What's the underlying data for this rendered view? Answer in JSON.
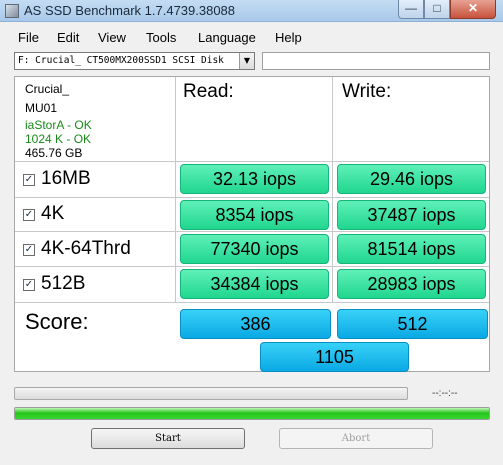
{
  "window": {
    "title": "AS SSD Benchmark 1.7.4739.38088"
  },
  "menu": [
    "File",
    "Edit",
    "View",
    "Tools",
    "Language",
    "Help"
  ],
  "drive": {
    "selected": "F: Crucial_ CT500MX200SSD1 SCSI Disk"
  },
  "info": {
    "model": "Crucial_",
    "firmware": "MU01",
    "driver": "iaStorA - OK",
    "alignment": "1024 K - OK",
    "size": "465.76 GB"
  },
  "columns": {
    "read": "Read:",
    "write": "Write:"
  },
  "rows": [
    {
      "label": "16MB",
      "checked": true,
      "read": "32.13 iops",
      "write": "29.46 iops"
    },
    {
      "label": "4K",
      "checked": true,
      "read": "8354 iops",
      "write": "37487 iops"
    },
    {
      "label": "4K-64Thrd",
      "checked": true,
      "read": "77340 iops",
      "write": "81514 iops"
    },
    {
      "label": "512B",
      "checked": true,
      "read": "34384 iops",
      "write": "28983 iops"
    }
  ],
  "score": {
    "label": "Score:",
    "read": "386",
    "write": "512",
    "total": "1105"
  },
  "progress": {
    "time": "--:--:--",
    "overall_fraction": 1.0
  },
  "buttons": {
    "start": "Start",
    "abort": "Abort"
  },
  "colors": {
    "result_green": "#2ee29c",
    "score_blue": "#1bbcef",
    "progress_green": "#2ecc26"
  }
}
